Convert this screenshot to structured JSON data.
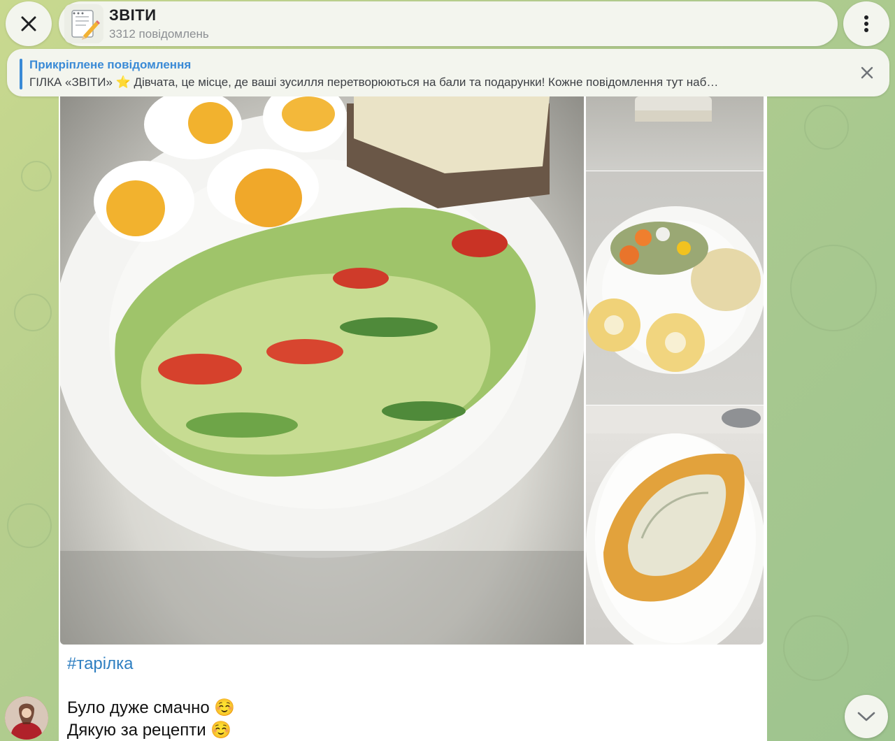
{
  "header": {
    "title": "ЗВІТИ",
    "subtitle": "3312 повідомлень"
  },
  "pinned": {
    "title": "Прикріплене повідомлення",
    "text": "ГІЛКА «ЗВІТИ» ⭐ Дівчата, це місце, де ваші зусилля перетворюються на бали та подарунки! Кожне повідомлення тут наб…"
  },
  "message": {
    "hashtag": "#тарілка",
    "line1": "Було дуже смачно ☺️",
    "line2": "Дякую за рецепти ☺️"
  },
  "icons": {
    "close": "close-icon",
    "menu": "more-vertical-icon",
    "chat_avatar": "memo-icon",
    "pinned_close": "close-icon",
    "scroll_down": "chevron-down-icon"
  },
  "colors": {
    "accent": "#3a8ad6",
    "link": "#2f7fc1",
    "background": "#b7cf8d"
  }
}
